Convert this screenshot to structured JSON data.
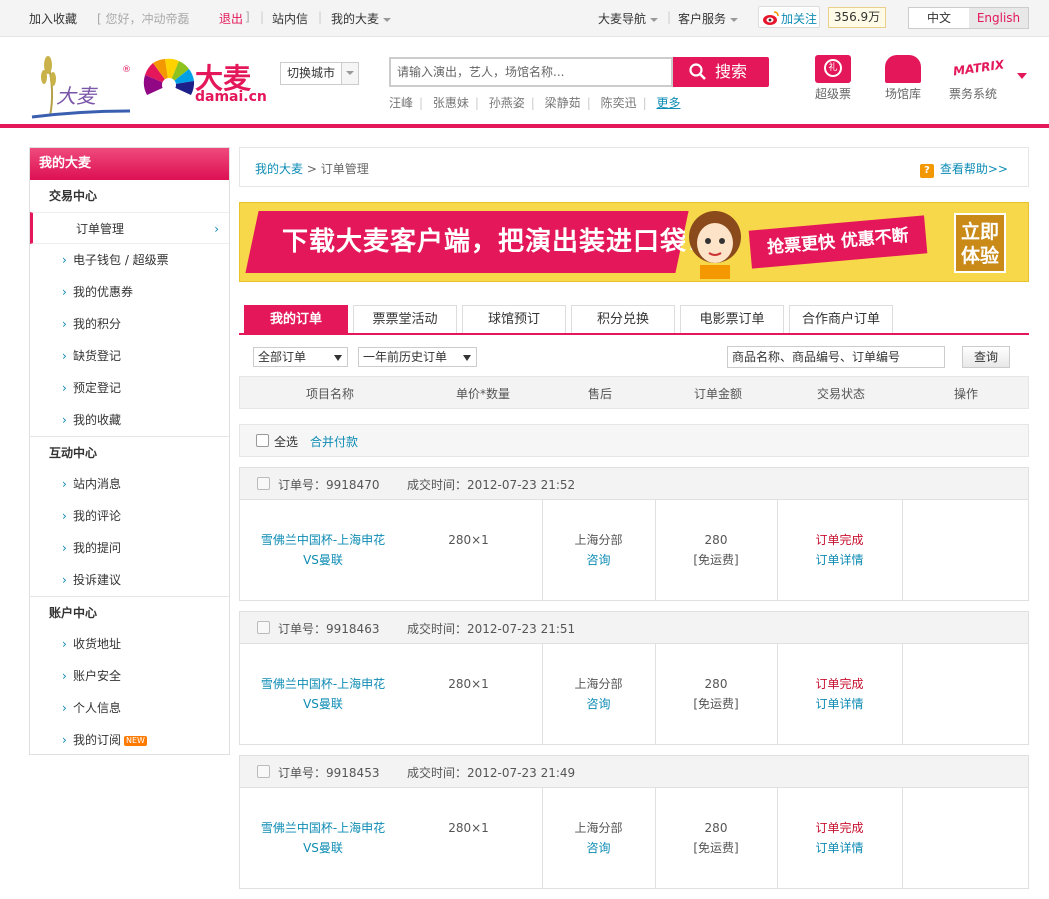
{
  "topbar": {
    "add_fav": "加入收藏",
    "greeting": "[ 您好，冲动帝磊",
    "logout": "退出",
    "close_bracket": "]",
    "messages": "站内信",
    "my_damai": "我的大麦",
    "nav": "大麦导航",
    "service": "客户服务",
    "follow": "加关注",
    "fans": "356.9万",
    "lang_zh": "中文",
    "lang_en": "English"
  },
  "header": {
    "logo_text": "大麦",
    "logo_sub": "damai.cn",
    "city_switch": "切换城市",
    "search_placeholder": "请输入演出，艺人，场馆名称...",
    "search_button": "搜索",
    "hot_words": [
      "汪峰",
      "张惠妹",
      "孙燕姿",
      "梁静茹",
      "陈奕迅"
    ],
    "more": "更多",
    "quick_links": [
      {
        "label": "超级票",
        "icon": "gift-card-icon"
      },
      {
        "label": "场馆库",
        "icon": "venue-icon"
      },
      {
        "label": "票务系统",
        "icon": "matrix-icon"
      }
    ]
  },
  "sidebar": {
    "title": "我的大麦",
    "sections": [
      {
        "title": "交易中心",
        "items": [
          "订单管理",
          "电子钱包 / 超级票",
          "我的优惠券",
          "我的积分",
          "缺货登记",
          "预定登记",
          "我的收藏"
        ]
      },
      {
        "title": "互动中心",
        "items": [
          "站内消息",
          "我的评论",
          "我的提问",
          "投诉建议"
        ]
      },
      {
        "title": "账户中心",
        "items": [
          "收货地址",
          "账户安全",
          "个人信息",
          "我的订阅"
        ]
      }
    ],
    "new_badge": "NEW"
  },
  "breadcrumb": {
    "home": "我的大麦",
    "sep": ">",
    "current": "订单管理",
    "help": "查看帮助>>"
  },
  "banner": {
    "headline": "下载大麦客户端，把演出装进口袋!",
    "slogan": "抢票更快 优惠不断",
    "cta_line1": "立即",
    "cta_line2": "体验"
  },
  "tabs": [
    "我的订单",
    "票票堂活动",
    "球馆预订",
    "积分兑换",
    "电影票订单",
    "合作商户订单"
  ],
  "filter": {
    "status_select": "全部订单",
    "period_select": "一年前历史订单",
    "keyword_placeholder": "商品名称、商品编号、订单编号",
    "query_button": "查询"
  },
  "table_headers": [
    "项目名称",
    "单价*数量",
    "售后",
    "订单金额",
    "交易状态",
    "操作"
  ],
  "select_all": {
    "label": "全选",
    "merge_pay": "合并付款"
  },
  "orders": [
    {
      "no_label": "订单号：",
      "no": "9918470",
      "time_label": "成交时间：",
      "time": "2012-07-23 21:52",
      "name_line1": "雪佛兰中国杯-上海申花",
      "name_line2": "VS曼联",
      "price_qty": "280×1",
      "after_sale": "上海分部",
      "consult": "咨询",
      "amount": "280",
      "shipping": "[免运费]",
      "status": "订单完成",
      "detail": "订单详情"
    },
    {
      "no_label": "订单号：",
      "no": "9918463",
      "time_label": "成交时间：",
      "time": "2012-07-23 21:51",
      "name_line1": "雪佛兰中国杯-上海申花",
      "name_line2": "VS曼联",
      "price_qty": "280×1",
      "after_sale": "上海分部",
      "consult": "咨询",
      "amount": "280",
      "shipping": "[免运费]",
      "status": "订单完成",
      "detail": "订单详情"
    },
    {
      "no_label": "订单号：",
      "no": "9918453",
      "time_label": "成交时间：",
      "time": "2012-07-23 21:49",
      "name_line1": "雪佛兰中国杯-上海申花",
      "name_line2": "VS曼联",
      "price_qty": "280×1",
      "after_sale": "上海分部",
      "consult": "咨询",
      "amount": "280",
      "shipping": "[免运费]",
      "status": "订单完成",
      "detail": "订单详情"
    }
  ],
  "colors": {
    "brand": "#e3175a",
    "link": "#0e8cb4",
    "status": "#c8102e"
  }
}
